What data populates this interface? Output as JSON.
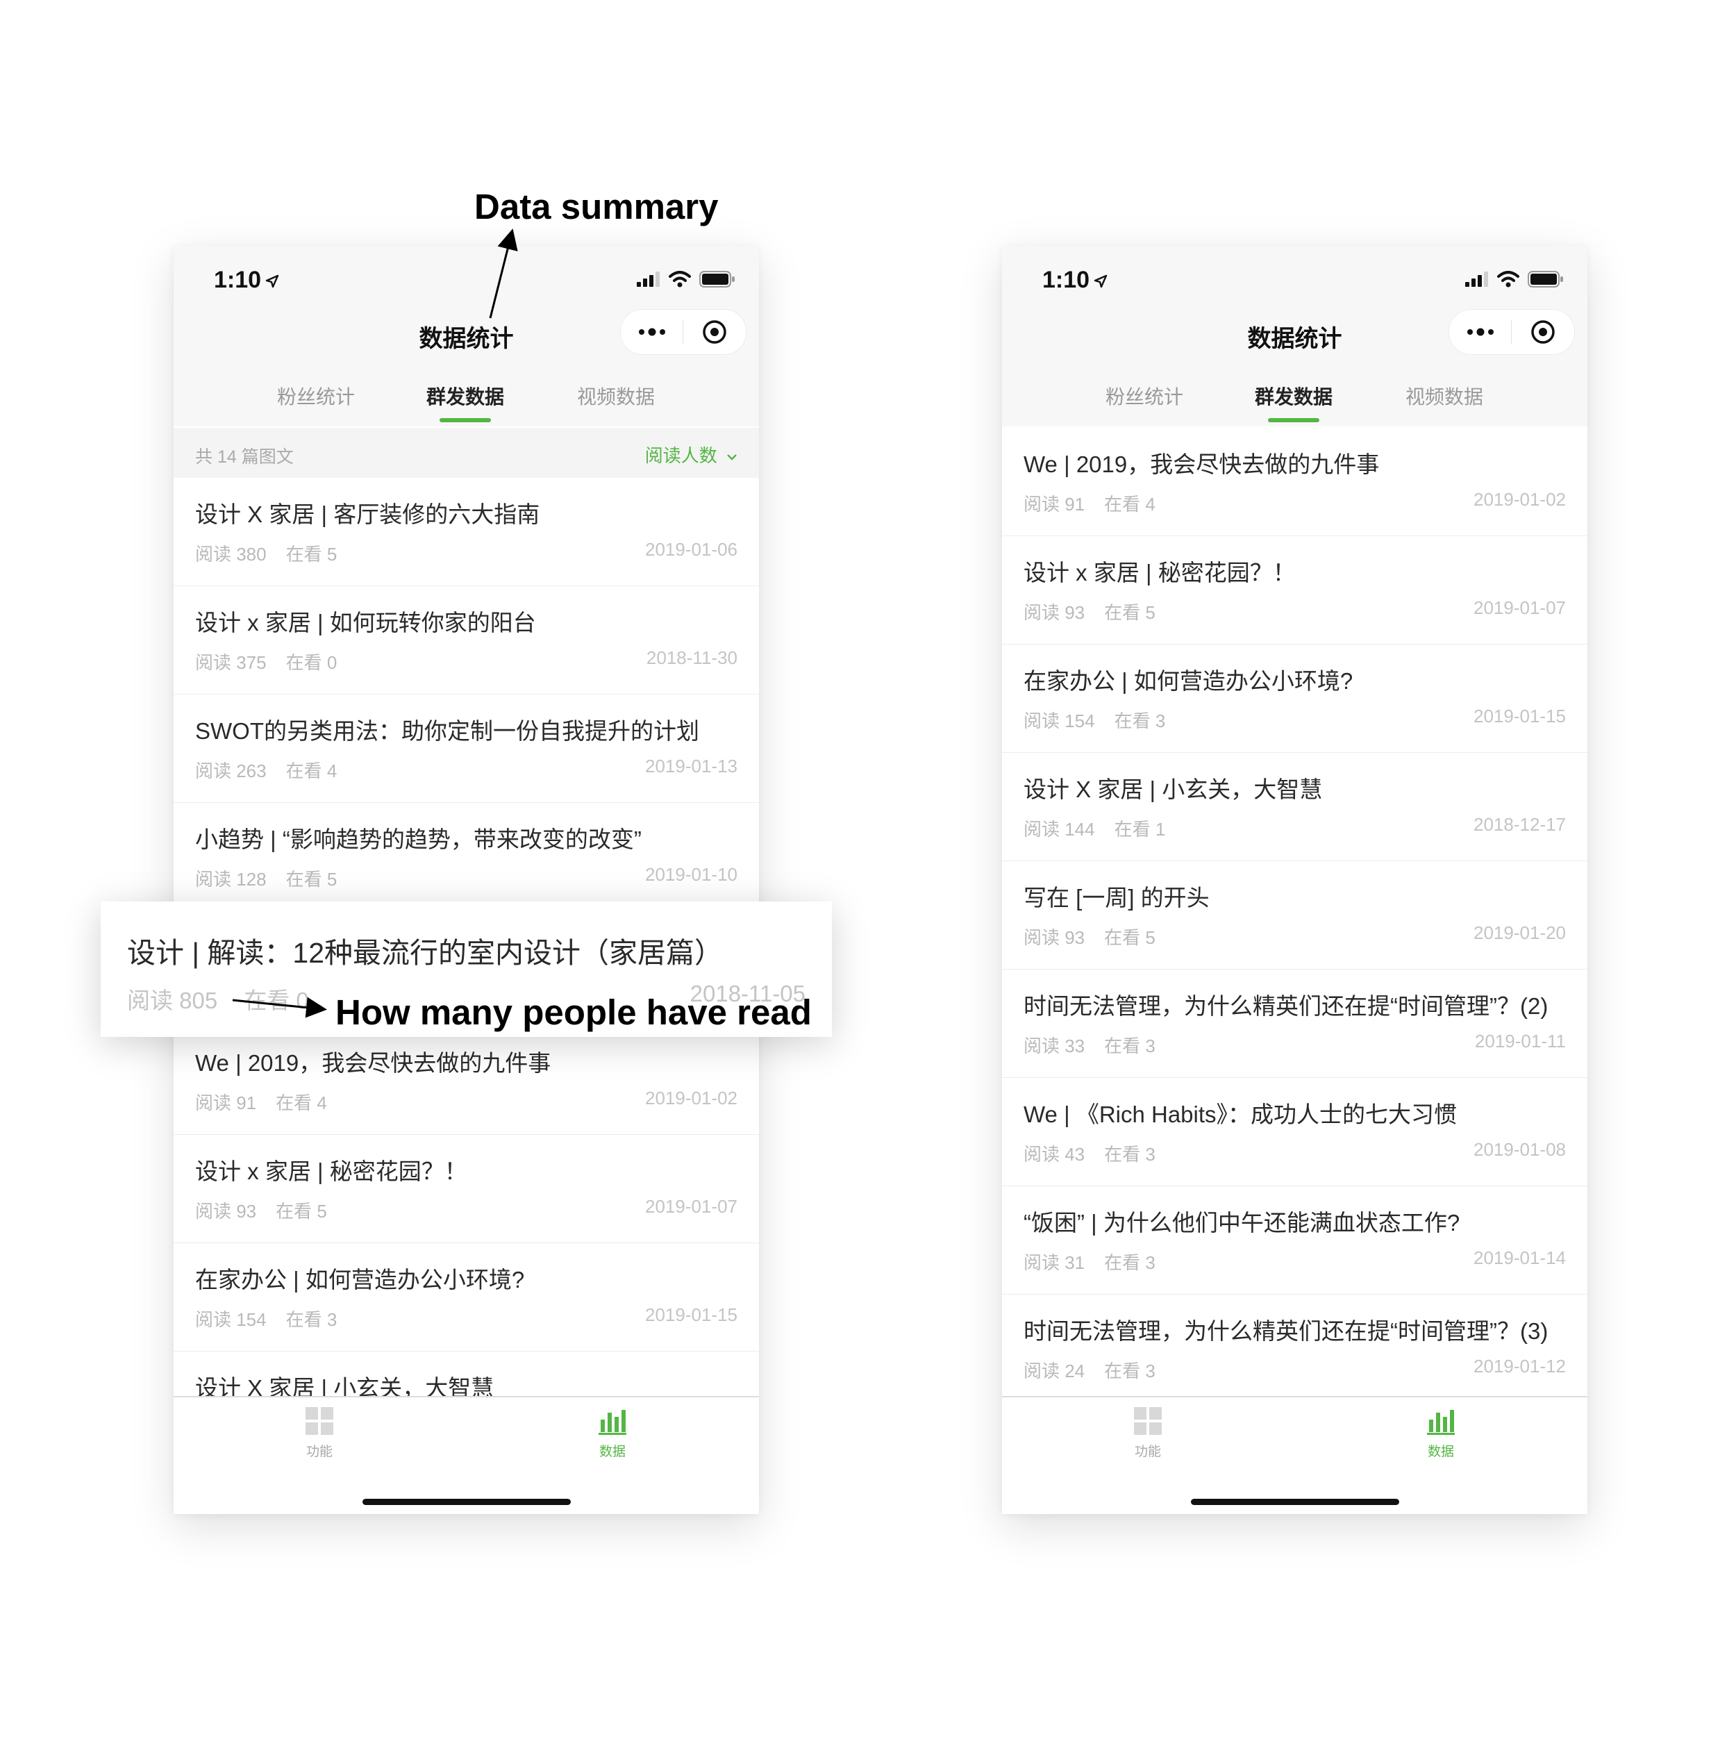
{
  "annotations": {
    "data_summary": "Data summary",
    "how_many_read": "How many people have read"
  },
  "status_bar": {
    "time": "1:10"
  },
  "nav": {
    "title": "数据统计",
    "more_icon": "more-dots-icon",
    "close_icon": "record-circle-icon"
  },
  "tabs": [
    {
      "label": "粉丝统计",
      "active": false
    },
    {
      "label": "群发数据",
      "active": true
    },
    {
      "label": "视频数据",
      "active": false
    }
  ],
  "summary": {
    "count_text": "共 14 篇图文",
    "sort_label": "阅读人数"
  },
  "left_list": [
    {
      "title": "设计 X 家居 | 客厅装修的六大指南",
      "read": "阅读 380",
      "watch": "在看 5",
      "date": "2019-01-06"
    },
    {
      "title": "设计 x 家居 | 如何玩转你家的阳台",
      "read": "阅读 375",
      "watch": "在看 0",
      "date": "2018-11-30"
    },
    {
      "title": "SWOT的另类用法：助你定制一份自我提升的计划",
      "read": "阅读 263",
      "watch": "在看 4",
      "date": "2019-01-13"
    },
    {
      "title": "小趋势 | “影响趋势的趋势，带来改变的改变”",
      "read": "阅读 128",
      "watch": "在看 5",
      "date": "2019-01-10"
    }
  ],
  "left_list_lower": [
    {
      "title": "We | 2019，我会尽快去做的九件事",
      "read": "阅读 91",
      "watch": "在看 4",
      "date": "2019-01-02"
    },
    {
      "title": "设计 x 家居 | 秘密花园？！",
      "read": "阅读 93",
      "watch": "在看 5",
      "date": "2019-01-07"
    },
    {
      "title": "在家办公 | 如何营造办公小环境?",
      "read": "阅读 154",
      "watch": "在看 3",
      "date": "2019-01-15"
    },
    {
      "title": "设计 X 家居 | 小玄关，大智慧"
    }
  ],
  "highlight_item": {
    "title": "设计 | 解读：12种最流行的室内设计（家居篇）",
    "read": "阅读 805",
    "watch": "在看 0",
    "date": "2018-11-05"
  },
  "right_list": [
    {
      "title": "We | 2019，我会尽快去做的九件事",
      "read": "阅读 91",
      "watch": "在看 4",
      "date": "2019-01-02"
    },
    {
      "title": "设计 x 家居 | 秘密花园？！",
      "read": "阅读 93",
      "watch": "在看 5",
      "date": "2019-01-07"
    },
    {
      "title": "在家办公 | 如何营造办公小环境?",
      "read": "阅读 154",
      "watch": "在看 3",
      "date": "2019-01-15"
    },
    {
      "title": "设计 X 家居 | 小玄关，大智慧",
      "read": "阅读 144",
      "watch": "在看 1",
      "date": "2018-12-17"
    },
    {
      "title": "写在 [一周] 的开头",
      "read": "阅读 93",
      "watch": "在看 5",
      "date": "2019-01-20"
    },
    {
      "title": "时间无法管理，为什么精英们还在提“时间管理”？(2)",
      "read": "阅读 33",
      "watch": "在看 3",
      "date": "2019-01-11"
    },
    {
      "title": "We |  《Rich Habits》：成功人士的七大习惯",
      "read": "阅读 43",
      "watch": "在看 3",
      "date": "2019-01-08"
    },
    {
      "title": "“饭困” | 为什么他们中午还能满血状态工作?",
      "read": "阅读 31",
      "watch": "在看 3",
      "date": "2019-01-14"
    },
    {
      "title": "时间无法管理，为什么精英们还在提“时间管理”？(3)",
      "read": "阅读 24",
      "watch": "在看 3",
      "date": "2019-01-12"
    }
  ],
  "tabbar": [
    {
      "label": "功能",
      "icon": "grid-icon",
      "active": false
    },
    {
      "label": "数据",
      "icon": "bar-chart-icon",
      "active": true
    }
  ],
  "colors": {
    "accent": "#53b644",
    "inactive": "#999999",
    "tabbar_inactive": "#c8c8c8"
  }
}
